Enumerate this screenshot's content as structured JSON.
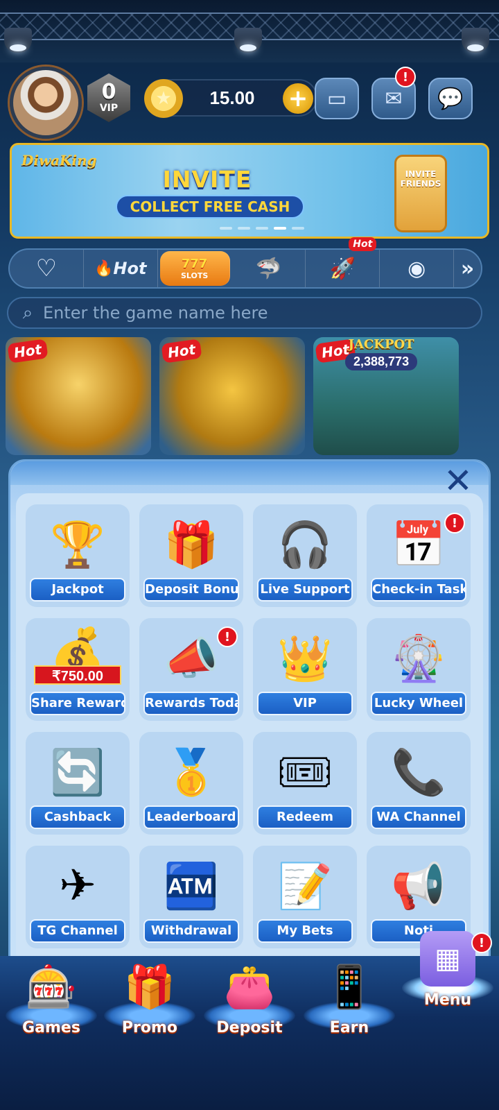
{
  "header": {
    "vip_level": "0",
    "vip_label": "VIP",
    "balance": "15.00",
    "mail_badge": "!"
  },
  "banner": {
    "brand": "DiwaKing",
    "title": "INVITE FRIENDS",
    "subtitle": "COLLECT FREE CASH",
    "phone_text": "INVITE FRIENDS"
  },
  "categories": {
    "hot_label": "Hot",
    "slots_label": "SLOTS",
    "slots_mark": "777",
    "hot_tag": "Hot"
  },
  "search": {
    "placeholder": "Enter the game name here"
  },
  "games": {
    "hot_tag": "Hot",
    "jackpot_label": "JACKPOT",
    "jackpot_value": "2,388,773"
  },
  "menu": {
    "items": [
      {
        "label": "Jackpot"
      },
      {
        "label": "Deposit Bonus"
      },
      {
        "label": "Live Support"
      },
      {
        "label": "Check-in Task"
      },
      {
        "label": "Share Rewards",
        "amount": "₹750.00"
      },
      {
        "label": "Rewards Today"
      },
      {
        "label": "VIP"
      },
      {
        "label": "Lucky Wheel"
      },
      {
        "label": "Cashback"
      },
      {
        "label": "Leaderboard"
      },
      {
        "label": "Redeem"
      },
      {
        "label": "WA Channel"
      },
      {
        "label": "TG Channel"
      },
      {
        "label": "Withdrawal"
      },
      {
        "label": "My Bets"
      },
      {
        "label": "Noti"
      }
    ],
    "badge": "!"
  },
  "bottom_nav": {
    "games": "Games",
    "promo": "Promo",
    "deposit": "Deposit",
    "earn": "Earn",
    "menu": "Menu",
    "badge": "!"
  }
}
